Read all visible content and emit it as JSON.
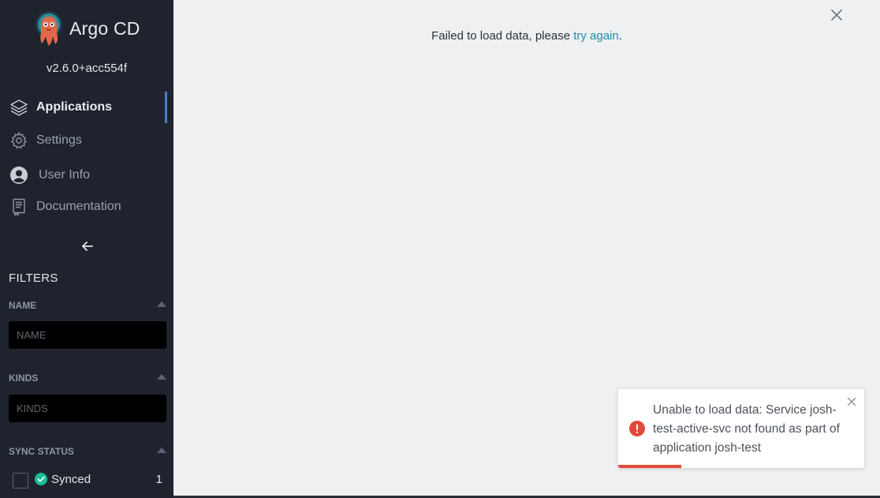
{
  "app": {
    "name": "Argo CD",
    "version": "v2.6.0+acc554f"
  },
  "nav": [
    {
      "label": "Applications",
      "icon": "layers-icon",
      "active": true
    },
    {
      "label": "Settings",
      "icon": "gear-icon",
      "active": false
    },
    {
      "label": "User Info",
      "icon": "user-circle-icon",
      "active": false
    },
    {
      "label": "Documentation",
      "icon": "book-icon",
      "active": false
    }
  ],
  "filters": {
    "title": "FILTERS",
    "name": {
      "label": "NAME",
      "placeholder": "NAME",
      "value": ""
    },
    "kinds": {
      "label": "KINDS",
      "placeholder": "KINDS",
      "value": ""
    },
    "sync_status": {
      "label": "SYNC STATUS",
      "options": [
        {
          "label": "Synced",
          "count": "1",
          "checked": false
        }
      ]
    }
  },
  "main": {
    "message_prefix": "Failed to load data, please ",
    "message_link": "try again",
    "message_suffix": "."
  },
  "toast": {
    "text": "Unable to load data: Service josh-test-active-svc not found as part of application josh-test",
    "progress": 0.255,
    "color": "#e14a3b"
  },
  "colors": {
    "sidebar_bg": "#1f232d",
    "accent": "#4f7cc0",
    "link": "#1a8fa8",
    "synced": "#18be94",
    "error": "#e14a3b"
  }
}
